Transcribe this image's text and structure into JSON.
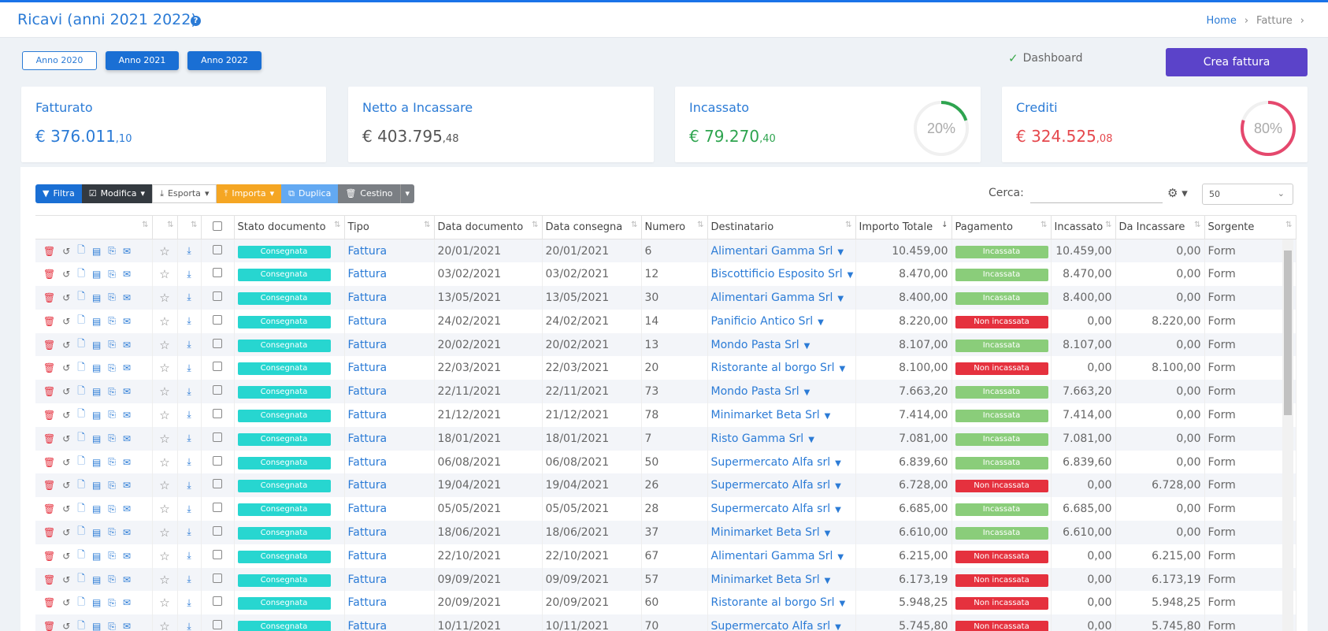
{
  "header": {
    "title": "Ricavi (anni 2021 2022)",
    "help_icon": "?",
    "breadcrumb": [
      "Home",
      "Fatture"
    ]
  },
  "years": {
    "y2020": "Anno 2020",
    "y2021": "Anno 2021",
    "y2022": "Anno 2022"
  },
  "dashboard_label": "Dashboard",
  "crea_label": "Crea fattura",
  "cards": [
    {
      "label": "Fatturato",
      "int": "€ 376.011",
      "dec": ",10",
      "color": "#2b7bd6"
    },
    {
      "label": "Netto a Incassare",
      "int": "€ 403.795",
      "dec": ",48",
      "color": "#555555"
    },
    {
      "label": "Incassato",
      "int": "€ 79.270",
      "dec": ",40",
      "color": "#2ea44f",
      "percent": "20%",
      "ring_fraction": 0.2,
      "ring_color": "#2ea44f"
    },
    {
      "label": "Crediti",
      "int": "€ 324.525",
      "dec": ",08",
      "color": "#e5484d",
      "percent": "80%",
      "ring_fraction": 0.8,
      "ring_color": "#e5486d"
    }
  ],
  "toolbar": {
    "filtra": "Filtra",
    "modifica": "Modifica",
    "esporta": "Esporta",
    "importa": "Importa",
    "duplica": "Duplica",
    "cestino": "Cestino"
  },
  "search": {
    "label": "Cerca:",
    "value": ""
  },
  "page_size": "50",
  "columns": [
    "Stato documento",
    "Tipo",
    "Data documento",
    "Data consegna",
    "Numero",
    "Destinatario",
    "Importo Totale",
    "Pagamento",
    "Incassato",
    "Da Incassare",
    "Sorgente"
  ],
  "rows": [
    {
      "stato": "Consegnata",
      "tipo": "Fattura",
      "data_doc": "20/01/2021",
      "data_cons": "20/01/2021",
      "numero": "6",
      "dest": "Alimentari Gamma Srl",
      "importo": "10.459,00",
      "pagamento": "Incassata",
      "paid": true,
      "incassato": "10.459,00",
      "da_incassare": "0,00",
      "sorgente": "Form"
    },
    {
      "stato": "Consegnata",
      "tipo": "Fattura",
      "data_doc": "03/02/2021",
      "data_cons": "03/02/2021",
      "numero": "12",
      "dest": "Biscottificio Esposito Srl",
      "importo": "8.470,00",
      "pagamento": "Incassata",
      "paid": true,
      "incassato": "8.470,00",
      "da_incassare": "0,00",
      "sorgente": "Form"
    },
    {
      "stato": "Consegnata",
      "tipo": "Fattura",
      "data_doc": "13/05/2021",
      "data_cons": "13/05/2021",
      "numero": "30",
      "dest": "Alimentari Gamma Srl",
      "importo": "8.400,00",
      "pagamento": "Incassata",
      "paid": true,
      "incassato": "8.400,00",
      "da_incassare": "0,00",
      "sorgente": "Form"
    },
    {
      "stato": "Consegnata",
      "tipo": "Fattura",
      "data_doc": "24/02/2021",
      "data_cons": "24/02/2021",
      "numero": "14",
      "dest": "Panificio Antico Srl",
      "importo": "8.220,00",
      "pagamento": "Non incassata",
      "paid": false,
      "incassato": "0,00",
      "da_incassare": "8.220,00",
      "sorgente": "Form"
    },
    {
      "stato": "Consegnata",
      "tipo": "Fattura",
      "data_doc": "20/02/2021",
      "data_cons": "20/02/2021",
      "numero": "13",
      "dest": "Mondo Pasta Srl",
      "importo": "8.107,00",
      "pagamento": "Incassata",
      "paid": true,
      "incassato": "8.107,00",
      "da_incassare": "0,00",
      "sorgente": "Form"
    },
    {
      "stato": "Consegnata",
      "tipo": "Fattura",
      "data_doc": "22/03/2021",
      "data_cons": "22/03/2021",
      "numero": "20",
      "dest": "Ristorante al borgo Srl",
      "importo": "8.100,00",
      "pagamento": "Non incassata",
      "paid": false,
      "incassato": "0,00",
      "da_incassare": "8.100,00",
      "sorgente": "Form"
    },
    {
      "stato": "Consegnata",
      "tipo": "Fattura",
      "data_doc": "22/11/2021",
      "data_cons": "22/11/2021",
      "numero": "73",
      "dest": "Mondo Pasta Srl",
      "importo": "7.663,20",
      "pagamento": "Incassata",
      "paid": true,
      "incassato": "7.663,20",
      "da_incassare": "0,00",
      "sorgente": "Form"
    },
    {
      "stato": "Consegnata",
      "tipo": "Fattura",
      "data_doc": "21/12/2021",
      "data_cons": "21/12/2021",
      "numero": "78",
      "dest": "Minimarket Beta Srl",
      "importo": "7.414,00",
      "pagamento": "Incassata",
      "paid": true,
      "incassato": "7.414,00",
      "da_incassare": "0,00",
      "sorgente": "Form"
    },
    {
      "stato": "Consegnata",
      "tipo": "Fattura",
      "data_doc": "18/01/2021",
      "data_cons": "18/01/2021",
      "numero": "7",
      "dest": "Risto Gamma Srl",
      "importo": "7.081,00",
      "pagamento": "Incassata",
      "paid": true,
      "incassato": "7.081,00",
      "da_incassare": "0,00",
      "sorgente": "Form"
    },
    {
      "stato": "Consegnata",
      "tipo": "Fattura",
      "data_doc": "06/08/2021",
      "data_cons": "06/08/2021",
      "numero": "50",
      "dest": "Supermercato Alfa srl",
      "importo": "6.839,60",
      "pagamento": "Incassata",
      "paid": true,
      "incassato": "6.839,60",
      "da_incassare": "0,00",
      "sorgente": "Form"
    },
    {
      "stato": "Consegnata",
      "tipo": "Fattura",
      "data_doc": "19/04/2021",
      "data_cons": "19/04/2021",
      "numero": "26",
      "dest": "Supermercato Alfa srl",
      "importo": "6.728,00",
      "pagamento": "Non incassata",
      "paid": false,
      "incassato": "0,00",
      "da_incassare": "6.728,00",
      "sorgente": "Form"
    },
    {
      "stato": "Consegnata",
      "tipo": "Fattura",
      "data_doc": "05/05/2021",
      "data_cons": "05/05/2021",
      "numero": "28",
      "dest": "Supermercato Alfa srl",
      "importo": "6.685,00",
      "pagamento": "Incassata",
      "paid": true,
      "incassato": "6.685,00",
      "da_incassare": "0,00",
      "sorgente": "Form"
    },
    {
      "stato": "Consegnata",
      "tipo": "Fattura",
      "data_doc": "18/06/2021",
      "data_cons": "18/06/2021",
      "numero": "37",
      "dest": "Minimarket Beta Srl",
      "importo": "6.610,00",
      "pagamento": "Incassata",
      "paid": true,
      "incassato": "6.610,00",
      "da_incassare": "0,00",
      "sorgente": "Form"
    },
    {
      "stato": "Consegnata",
      "tipo": "Fattura",
      "data_doc": "22/10/2021",
      "data_cons": "22/10/2021",
      "numero": "67",
      "dest": "Alimentari Gamma Srl",
      "importo": "6.215,00",
      "pagamento": "Non incassata",
      "paid": false,
      "incassato": "0,00",
      "da_incassare": "6.215,00",
      "sorgente": "Form"
    },
    {
      "stato": "Consegnata",
      "tipo": "Fattura",
      "data_doc": "09/09/2021",
      "data_cons": "09/09/2021",
      "numero": "57",
      "dest": "Minimarket Beta Srl",
      "importo": "6.173,19",
      "pagamento": "Non incassata",
      "paid": false,
      "incassato": "0,00",
      "da_incassare": "6.173,19",
      "sorgente": "Form"
    },
    {
      "stato": "Consegnata",
      "tipo": "Fattura",
      "data_doc": "20/09/2021",
      "data_cons": "20/09/2021",
      "numero": "60",
      "dest": "Ristorante al borgo Srl",
      "importo": "5.948,25",
      "pagamento": "Non incassata",
      "paid": false,
      "incassato": "0,00",
      "da_incassare": "5.948,25",
      "sorgente": "Form"
    },
    {
      "stato": "Consegnata",
      "tipo": "Fattura",
      "data_doc": "10/11/2021",
      "data_cons": "10/11/2021",
      "numero": "70",
      "dest": "Supermercato Alfa srl",
      "importo": "5.745,80",
      "pagamento": "Non incassata",
      "paid": false,
      "incassato": "0,00",
      "da_incassare": "5.745,80",
      "sorgente": "Form"
    }
  ]
}
